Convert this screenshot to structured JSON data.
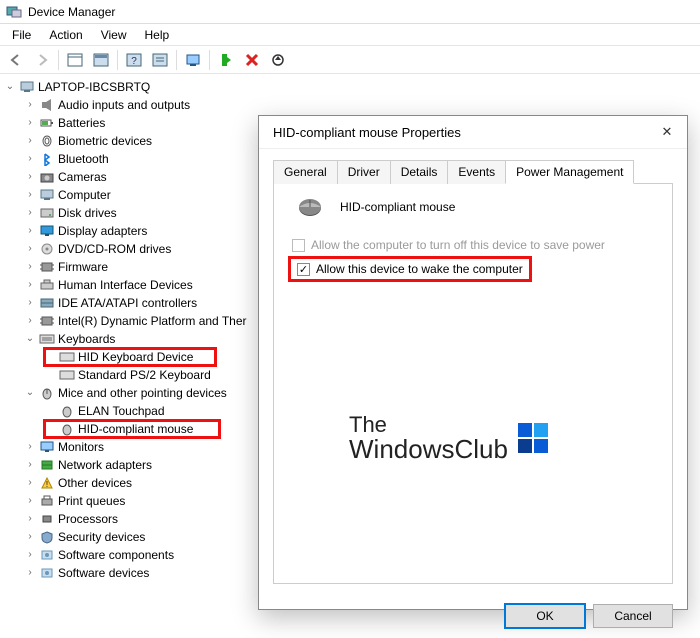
{
  "window": {
    "title": "Device Manager"
  },
  "menu": {
    "file": "File",
    "action": "Action",
    "view": "View",
    "help": "Help"
  },
  "tree": {
    "root": "LAPTOP-IBCSBRTQ",
    "nodes": [
      {
        "label": "Audio inputs and outputs",
        "icon": "audio"
      },
      {
        "label": "Batteries",
        "icon": "battery"
      },
      {
        "label": "Biometric devices",
        "icon": "finger"
      },
      {
        "label": "Bluetooth",
        "icon": "bt"
      },
      {
        "label": "Cameras",
        "icon": "camera"
      },
      {
        "label": "Computer",
        "icon": "pc"
      },
      {
        "label": "Disk drives",
        "icon": "disk"
      },
      {
        "label": "Display adapters",
        "icon": "display"
      },
      {
        "label": "DVD/CD-ROM drives",
        "icon": "cd"
      },
      {
        "label": "Firmware",
        "icon": "chip"
      },
      {
        "label": "Human Interface Devices",
        "icon": "hid"
      },
      {
        "label": "IDE ATA/ATAPI controllers",
        "icon": "ide"
      },
      {
        "label": "Intel(R) Dynamic Platform and Ther",
        "icon": "chip2"
      },
      {
        "label": "Keyboards",
        "icon": "kb",
        "expanded": true
      },
      {
        "label": "Mice and other pointing devices",
        "icon": "mouse",
        "expanded": true
      },
      {
        "label": "Monitors",
        "icon": "monitor"
      },
      {
        "label": "Network adapters",
        "icon": "net"
      },
      {
        "label": "Other devices",
        "icon": "other"
      },
      {
        "label": "Print queues",
        "icon": "print"
      },
      {
        "label": "Processors",
        "icon": "cpu"
      },
      {
        "label": "Security devices",
        "icon": "sec"
      },
      {
        "label": "Software components",
        "icon": "sw"
      },
      {
        "label": "Software devices",
        "icon": "sw2"
      }
    ],
    "keyboards_children": [
      {
        "label": "HID Keyboard Device"
      },
      {
        "label": "Standard PS/2 Keyboard"
      }
    ],
    "mice_children": [
      {
        "label": "ELAN Touchpad"
      },
      {
        "label": "HID-compliant mouse"
      }
    ]
  },
  "dialog": {
    "title": "HID-compliant mouse Properties",
    "tabs": {
      "general": "General",
      "driver": "Driver",
      "details": "Details",
      "events": "Events",
      "power": "Power Management"
    },
    "device_name": "HID-compliant mouse",
    "opt_turnoff": "Allow the computer to turn off this device to save power",
    "opt_wake": "Allow this device to wake the computer",
    "ok": "OK",
    "cancel": "Cancel"
  },
  "watermark": {
    "line1": "The",
    "line2": "WindowsClub"
  }
}
